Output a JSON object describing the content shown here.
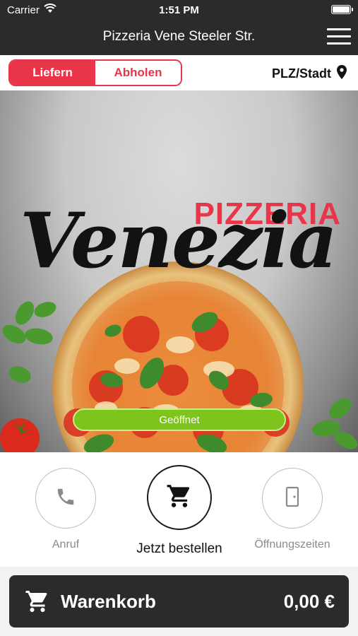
{
  "status_bar": {
    "carrier": "Carrier",
    "time": "1:51 PM"
  },
  "nav": {
    "title": "Pizzeria Vene Steeler Str."
  },
  "mode": {
    "deliver": "Liefern",
    "pickup": "Abholen",
    "selected": "Liefern",
    "location": "PLZ/Stadt"
  },
  "hero": {
    "brand_top": "PIZZERIA",
    "brand_script": "Venezia",
    "status": "Geöffnet"
  },
  "actions": {
    "call": "Anruf",
    "order": "Jetzt bestellen",
    "hours": "Öffnungszeiten"
  },
  "cart": {
    "label": "Warenkorb",
    "total": "0,00 €"
  },
  "colors": {
    "accent": "#e8354a",
    "open_green": "#7dc41c",
    "dark": "#2b2b2b"
  },
  "icons": [
    "wifi-icon",
    "battery-icon",
    "menu-icon",
    "location-pin-icon",
    "phone-icon",
    "cart-icon",
    "door-icon"
  ]
}
